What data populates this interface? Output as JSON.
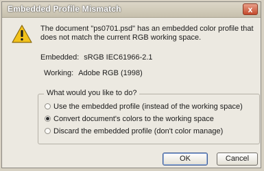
{
  "dialog": {
    "title": "Embedded Profile Mismatch",
    "close_glyph": "x",
    "message": "The document \"ps0701.psd\" has an embedded color profile that does not match the current RGB working space.",
    "icon": "warning-icon"
  },
  "profiles": {
    "embedded_label": "Embedded:",
    "embedded_value": "sRGB IEC61966-2.1",
    "working_label": "Working:",
    "working_value": "Adobe RGB (1998)"
  },
  "options": {
    "legend": "What would you like to do?",
    "items": [
      {
        "label": "Use the embedded profile (instead of the working space)",
        "selected": false
      },
      {
        "label": "Convert document's colors to the working space",
        "selected": true
      },
      {
        "label": "Discard the embedded profile (don't color manage)",
        "selected": false
      }
    ]
  },
  "buttons": {
    "ok_label": "OK",
    "cancel_label": "Cancel"
  },
  "colors": {
    "warning_fill": "#f2c21b",
    "close_button": "#c44a2c"
  }
}
